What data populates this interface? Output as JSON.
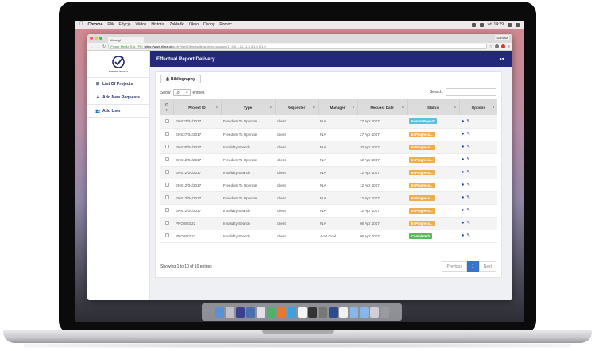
{
  "menubar": {
    "app_name": "Chrome",
    "items": [
      "Plik",
      "Edycja",
      "Widok",
      "Historia",
      "Zakładki",
      "Okno",
      "Osoby",
      "Pomoc"
    ],
    "clock": "wt. 14:29"
  },
  "browser": {
    "tab_title": "tilma.gl",
    "profile_label": "Dariusz",
    "secure_label": "Power Media S.A. [PL]",
    "url_host": "https://www.tilma.gl",
    "url_path": "/gi-bin/WebObjects/tilma-demo.woa/wo/17.0.0.1.21.11.3.3.1.0.0.1.0"
  },
  "app": {
    "logo_text": "Effectual Services",
    "header_title": "Effectual Report Delivery",
    "user_menu_icon": "user-icon",
    "sidebar": [
      {
        "label": "List Of Projects",
        "icon": "list-icon",
        "glyph": "☰"
      },
      {
        "label": "Add New Requests",
        "icon": "plus-icon",
        "glyph": "+"
      },
      {
        "label": "Add User",
        "icon": "add-user-icon",
        "glyph": "👥"
      }
    ],
    "bibliography_label": "Bibliography",
    "show_label": "Show",
    "entries_label": "entries",
    "page_length": "10",
    "search_label": "Search:",
    "columns": [
      "Project ID",
      "Type",
      "Requester",
      "Manager",
      "Request Date",
      "Status",
      "Options"
    ],
    "rows": [
      {
        "id": "EKS27/04/2017",
        "type": "Freedom To Operate",
        "requester": "client",
        "manager": "N.A",
        "date": "27 Apr 2017",
        "status": "Interim Report",
        "status_kind": "interim"
      },
      {
        "id": "EKS27/04/2017",
        "type": "Freedom To Operate",
        "requester": "client",
        "manager": "N.A",
        "date": "27 Apr 2017",
        "status": "In Progress...",
        "status_kind": "progress"
      },
      {
        "id": "EKS20/04/2017",
        "type": "Invalidity Search",
        "requester": "client",
        "manager": "N.A",
        "date": "20 Apr 2017",
        "status": "In Progress...",
        "status_kind": "progress"
      },
      {
        "id": "EKS12/04/2017",
        "type": "Freedom To Operate",
        "requester": "client",
        "manager": "N.A",
        "date": "12 Apr 2017",
        "status": "In Progress...",
        "status_kind": "progress"
      },
      {
        "id": "EKS12/04/2017",
        "type": "Invalidity Search",
        "requester": "client",
        "manager": "N.A",
        "date": "12 Apr 2017",
        "status": "In Progress...",
        "status_kind": "progress"
      },
      {
        "id": "EKS12/04/2017",
        "type": "Freedom To Operate",
        "requester": "client",
        "manager": "N.A",
        "date": "12 Apr 2017",
        "status": "In Progress...",
        "status_kind": "progress"
      },
      {
        "id": "EKS12/04/2017",
        "type": "Freedom To Operate",
        "requester": "client",
        "manager": "N.A",
        "date": "12 Apr 2017",
        "status": "In Progress...",
        "status_kind": "progress"
      },
      {
        "id": "EKS12/04/2017",
        "type": "Invalidity Search",
        "requester": "client",
        "manager": "N.A",
        "date": "12 Apr 2017",
        "status": "In Progress...",
        "status_kind": "progress"
      },
      {
        "id": "PRO280122",
        "type": "Invalidity Search",
        "requester": "client",
        "manager": "N.A",
        "date": "06 Apr 2017",
        "status": "In Progress...",
        "status_kind": "progress"
      },
      {
        "id": "PRO280121",
        "type": "Invalidity Search",
        "requester": "client",
        "manager": "Amit Goel",
        "date": "06 Apr 2017",
        "status": "Completed!",
        "status_kind": "completed"
      }
    ],
    "footer_info": "Showing 1 to 10 of 10 entries",
    "pager": {
      "previous": "Previous",
      "current": "1",
      "next": "Next"
    },
    "status_colors": {
      "interim": "#5bc0de",
      "progress": "#f0ad4e",
      "completed": "#5cb85c"
    },
    "accent_color": "#23287a"
  }
}
